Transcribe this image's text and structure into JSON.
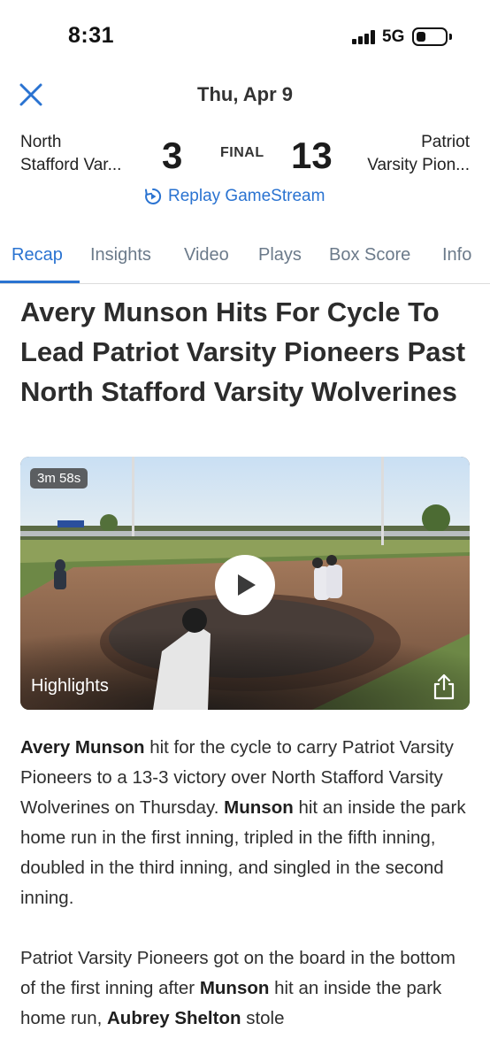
{
  "status": {
    "time": "8:31",
    "network": "5G",
    "signal_icon": "cellular-signal-icon",
    "battery_icon": "battery-icon",
    "battery_level": 0.25
  },
  "header": {
    "close_icon": "close-icon",
    "date": "Thu, Apr 9"
  },
  "score": {
    "home_team_line1": "North",
    "home_team_line2": "Stafford Var...",
    "home_score": "3",
    "status": "FINAL",
    "away_score": "13",
    "away_team_line1": "Patriot",
    "away_team_line2": "Varsity Pion..."
  },
  "replay": {
    "label": "Replay GameStream",
    "icon": "replay-icon"
  },
  "tabs": [
    {
      "label": "Recap",
      "active": true
    },
    {
      "label": "Insights",
      "active": false
    },
    {
      "label": "Video",
      "active": false
    },
    {
      "label": "Plays",
      "active": false
    },
    {
      "label": "Box Score",
      "active": false
    },
    {
      "label": "Info",
      "active": false
    }
  ],
  "article": {
    "title": "Avery Munson Hits For Cycle To Lead Patriot Varsity Pioneers Past North Stafford Varsity Wolverines",
    "video": {
      "duration": "3m 58s",
      "label": "Highlights",
      "play_icon": "play-icon",
      "share_icon": "share-icon"
    },
    "paragraph1": {
      "s1_bold": "Avery Munson",
      "s1_text": " hit for the cycle to carry Patriot Varsity Pioneers to a 13-3 victory over North Stafford Varsity Wolverines on Thursday. ",
      "s2_bold": "Munson",
      "s2_text": " hit an inside the park home run in the first inning, tripled in the fifth inning, doubled in the third inning, and singled in the second inning."
    },
    "paragraph2": {
      "s1_text": "Patriot Varsity Pioneers got on the board in the bottom of the first inning after ",
      "s1_bold": "Munson",
      "s2_text": " hit an inside the park home run, ",
      "s2_bold": "Aubrey Shelton",
      "s3_text": " stole"
    }
  },
  "colors": {
    "accent": "#2a73d1",
    "tab_inactive": "#6b7a8a",
    "text": "#2c2c2c"
  }
}
